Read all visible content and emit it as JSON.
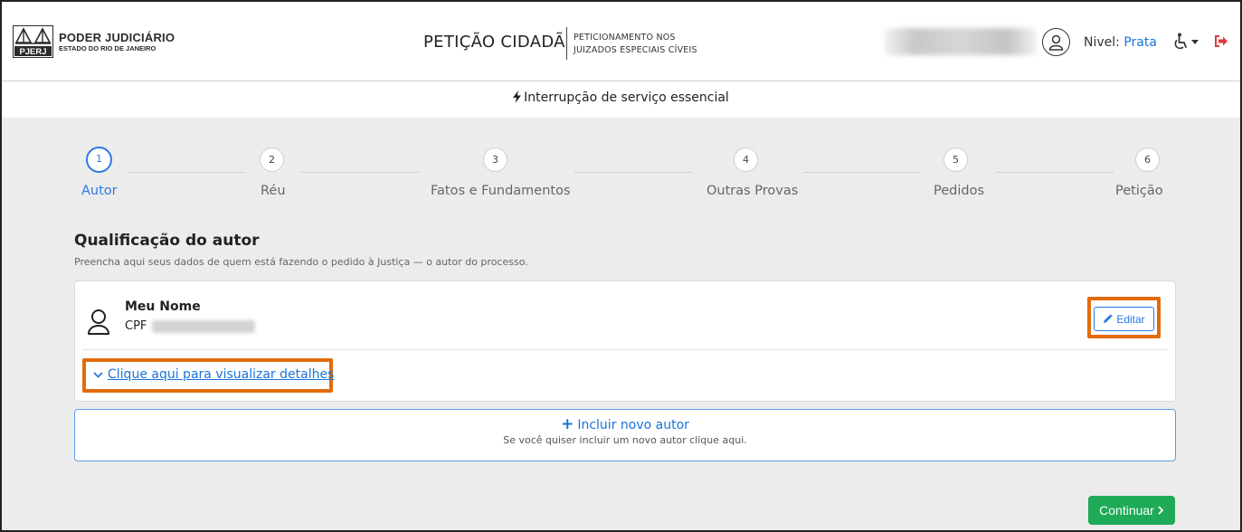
{
  "header": {
    "logo_line1": "PODER JUDICIÁRIO",
    "logo_line2": "ESTADO DO RIO DE JANEIRO",
    "logo_badge": "PJERJ",
    "app_title": "PETIÇÃO CIDADÃ",
    "app_subtitle_line1": "PETICIONAMENTO NOS",
    "app_subtitle_line2": "JUIZADOS ESPECIAIS CÍVEIS",
    "level_label": "Nivel:",
    "level_value": "Prata"
  },
  "notice": {
    "text": "Interrupção de serviço essencial"
  },
  "stepper": {
    "steps": [
      {
        "number": "1",
        "label": "Autor",
        "active": true
      },
      {
        "number": "2",
        "label": "Réu",
        "active": false
      },
      {
        "number": "3",
        "label": "Fatos e Fundamentos",
        "active": false
      },
      {
        "number": "4",
        "label": "Outras Provas",
        "active": false
      },
      {
        "number": "5",
        "label": "Pedidos",
        "active": false
      },
      {
        "number": "6",
        "label": "Petição",
        "active": false
      }
    ]
  },
  "section": {
    "title": "Qualificação do autor",
    "subtitle": "Preencha aqui seus dados de quem está fazendo o pedido à Justiça — o autor do processo."
  },
  "author_card": {
    "name": "Meu Nome",
    "cpf_label": "CPF",
    "edit_label": "Editar",
    "details_link": "Clique aqui para visualizar detalhes"
  },
  "include_author": {
    "title": "Incluir novo autor",
    "subtitle": "Se você quiser incluir um novo autor clique aqui."
  },
  "continue_label": "Continuar",
  "colors": {
    "accent": "#2a7be4",
    "highlight": "#e36c0a",
    "continue": "#1faa58",
    "logout": "#e0393e"
  }
}
